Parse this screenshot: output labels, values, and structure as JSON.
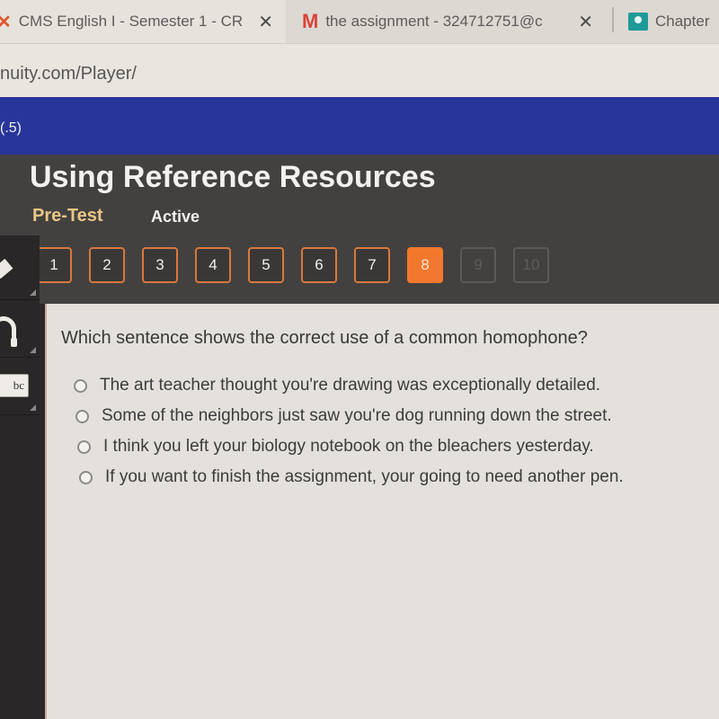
{
  "browser": {
    "tabs": [
      {
        "title": "CMS English I - Semester 1 - CR",
        "favicon": "edgenuity-icon",
        "active": true,
        "close": "✕"
      },
      {
        "title": "the assignment - 324712751@c",
        "favicon": "gmail-icon",
        "active": false,
        "close": "✕"
      },
      {
        "title": "Chapter",
        "favicon": "google-classroom-icon",
        "active": false
      }
    ],
    "url": "nuity.com/Player/"
  },
  "course": {
    "score_fragment": "(.5)"
  },
  "activity": {
    "title": "Using Reference Resources",
    "type": "Pre-Test",
    "status": "Active",
    "question_nav": [
      {
        "label": "1",
        "state": "answered"
      },
      {
        "label": "2",
        "state": "answered"
      },
      {
        "label": "3",
        "state": "answered"
      },
      {
        "label": "4",
        "state": "answered"
      },
      {
        "label": "5",
        "state": "answered"
      },
      {
        "label": "6",
        "state": "answered"
      },
      {
        "label": "7",
        "state": "answered"
      },
      {
        "label": "8",
        "state": "current"
      },
      {
        "label": "9",
        "state": "locked"
      },
      {
        "label": "10",
        "state": "locked"
      }
    ]
  },
  "tools": [
    {
      "name": "pencil-icon"
    },
    {
      "name": "headphones-icon"
    },
    {
      "name": "dictionary-icon",
      "label": "bc"
    }
  ],
  "question": {
    "prompt": "Which sentence shows the correct use of a common homophone?",
    "options": [
      "The art teacher thought you're drawing was exceptionally detailed.",
      "Some of the neighbors just saw you're dog running down the street.",
      "I think you left your biology notebook on the bleachers yesterday.",
      "If you want to finish the assignment, your going to need another pen."
    ]
  },
  "colors": {
    "course_header": "#28369a",
    "activity_header": "#434140",
    "accent_orange": "#f2782d",
    "pretest_label": "#e9c684"
  }
}
